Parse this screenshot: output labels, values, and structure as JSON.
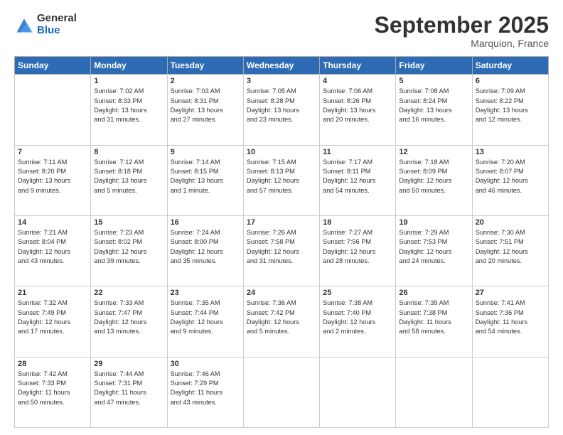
{
  "header": {
    "logo_general": "General",
    "logo_blue": "Blue",
    "month_title": "September 2025",
    "location": "Marquion, France"
  },
  "days_of_week": [
    "Sunday",
    "Monday",
    "Tuesday",
    "Wednesday",
    "Thursday",
    "Friday",
    "Saturday"
  ],
  "weeks": [
    [
      {
        "num": "",
        "info": ""
      },
      {
        "num": "1",
        "info": "Sunrise: 7:02 AM\nSunset: 8:33 PM\nDaylight: 13 hours\nand 31 minutes."
      },
      {
        "num": "2",
        "info": "Sunrise: 7:03 AM\nSunset: 8:31 PM\nDaylight: 13 hours\nand 27 minutes."
      },
      {
        "num": "3",
        "info": "Sunrise: 7:05 AM\nSunset: 8:28 PM\nDaylight: 13 hours\nand 23 minutes."
      },
      {
        "num": "4",
        "info": "Sunrise: 7:06 AM\nSunset: 8:26 PM\nDaylight: 13 hours\nand 20 minutes."
      },
      {
        "num": "5",
        "info": "Sunrise: 7:08 AM\nSunset: 8:24 PM\nDaylight: 13 hours\nand 16 minutes."
      },
      {
        "num": "6",
        "info": "Sunrise: 7:09 AM\nSunset: 8:22 PM\nDaylight: 13 hours\nand 12 minutes."
      }
    ],
    [
      {
        "num": "7",
        "info": "Sunrise: 7:11 AM\nSunset: 8:20 PM\nDaylight: 13 hours\nand 9 minutes."
      },
      {
        "num": "8",
        "info": "Sunrise: 7:12 AM\nSunset: 8:18 PM\nDaylight: 13 hours\nand 5 minutes."
      },
      {
        "num": "9",
        "info": "Sunrise: 7:14 AM\nSunset: 8:15 PM\nDaylight: 13 hours\nand 1 minute."
      },
      {
        "num": "10",
        "info": "Sunrise: 7:15 AM\nSunset: 8:13 PM\nDaylight: 12 hours\nand 57 minutes."
      },
      {
        "num": "11",
        "info": "Sunrise: 7:17 AM\nSunset: 8:11 PM\nDaylight: 12 hours\nand 54 minutes."
      },
      {
        "num": "12",
        "info": "Sunrise: 7:18 AM\nSunset: 8:09 PM\nDaylight: 12 hours\nand 50 minutes."
      },
      {
        "num": "13",
        "info": "Sunrise: 7:20 AM\nSunset: 8:07 PM\nDaylight: 12 hours\nand 46 minutes."
      }
    ],
    [
      {
        "num": "14",
        "info": "Sunrise: 7:21 AM\nSunset: 8:04 PM\nDaylight: 12 hours\nand 43 minutes."
      },
      {
        "num": "15",
        "info": "Sunrise: 7:23 AM\nSunset: 8:02 PM\nDaylight: 12 hours\nand 39 minutes."
      },
      {
        "num": "16",
        "info": "Sunrise: 7:24 AM\nSunset: 8:00 PM\nDaylight: 12 hours\nand 35 minutes."
      },
      {
        "num": "17",
        "info": "Sunrise: 7:26 AM\nSunset: 7:58 PM\nDaylight: 12 hours\nand 31 minutes."
      },
      {
        "num": "18",
        "info": "Sunrise: 7:27 AM\nSunset: 7:56 PM\nDaylight: 12 hours\nand 28 minutes."
      },
      {
        "num": "19",
        "info": "Sunrise: 7:29 AM\nSunset: 7:53 PM\nDaylight: 12 hours\nand 24 minutes."
      },
      {
        "num": "20",
        "info": "Sunrise: 7:30 AM\nSunset: 7:51 PM\nDaylight: 12 hours\nand 20 minutes."
      }
    ],
    [
      {
        "num": "21",
        "info": "Sunrise: 7:32 AM\nSunset: 7:49 PM\nDaylight: 12 hours\nand 17 minutes."
      },
      {
        "num": "22",
        "info": "Sunrise: 7:33 AM\nSunset: 7:47 PM\nDaylight: 12 hours\nand 13 minutes."
      },
      {
        "num": "23",
        "info": "Sunrise: 7:35 AM\nSunset: 7:44 PM\nDaylight: 12 hours\nand 9 minutes."
      },
      {
        "num": "24",
        "info": "Sunrise: 7:36 AM\nSunset: 7:42 PM\nDaylight: 12 hours\nand 5 minutes."
      },
      {
        "num": "25",
        "info": "Sunrise: 7:38 AM\nSunset: 7:40 PM\nDaylight: 12 hours\nand 2 minutes."
      },
      {
        "num": "26",
        "info": "Sunrise: 7:39 AM\nSunset: 7:38 PM\nDaylight: 11 hours\nand 58 minutes."
      },
      {
        "num": "27",
        "info": "Sunrise: 7:41 AM\nSunset: 7:36 PM\nDaylight: 11 hours\nand 54 minutes."
      }
    ],
    [
      {
        "num": "28",
        "info": "Sunrise: 7:42 AM\nSunset: 7:33 PM\nDaylight: 11 hours\nand 50 minutes."
      },
      {
        "num": "29",
        "info": "Sunrise: 7:44 AM\nSunset: 7:31 PM\nDaylight: 11 hours\nand 47 minutes."
      },
      {
        "num": "30",
        "info": "Sunrise: 7:46 AM\nSunset: 7:29 PM\nDaylight: 11 hours\nand 43 minutes."
      },
      {
        "num": "",
        "info": ""
      },
      {
        "num": "",
        "info": ""
      },
      {
        "num": "",
        "info": ""
      },
      {
        "num": "",
        "info": ""
      }
    ]
  ]
}
